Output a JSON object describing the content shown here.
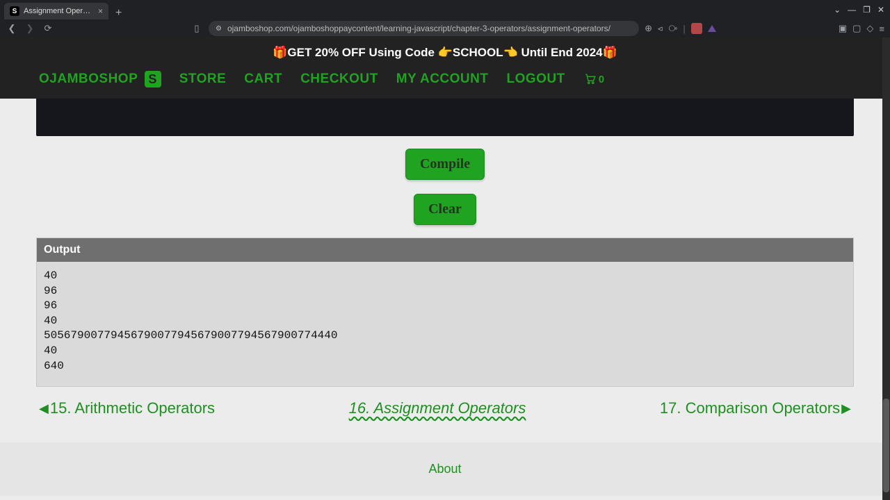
{
  "browser": {
    "tab_title": "Assignment Operators - Oj",
    "url": "ojamboshop.com/ojamboshoppaycontent/learning-javascript/chapter-3-operators/assignment-operators/"
  },
  "header": {
    "promo": "🎁GET 20% OFF Using Code 👉SCHOOL👈 Until End 2024🎁",
    "brand": "OJAMBOSHOP",
    "nav": [
      "STORE",
      "CART",
      "CHECKOUT",
      "MY ACCOUNT",
      "LOGOUT"
    ],
    "cart_count": "0"
  },
  "buttons": {
    "compile": "Compile",
    "clear": "Clear"
  },
  "output": {
    "heading": "Output",
    "lines": [
      "40",
      "96",
      "96",
      "40",
      "50567900779456790077945679007794567900774440",
      "40",
      "640"
    ]
  },
  "pager": {
    "prev": "15. Arithmetic Operators",
    "current": "16. Assignment Operators",
    "next": "17. Comparison Operators"
  },
  "footer": {
    "about": "About"
  }
}
